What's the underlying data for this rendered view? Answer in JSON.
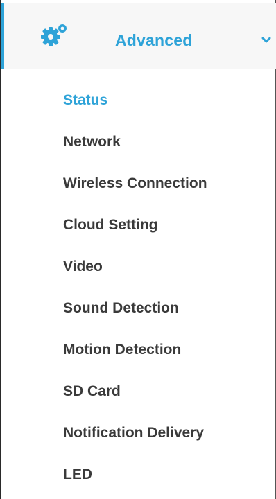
{
  "header": {
    "icon": "gears-icon",
    "label": "Advanced",
    "chevron_icon": "chevron-down-icon",
    "accent_color": "#2ea3d8"
  },
  "menu": {
    "items": [
      {
        "label": "Status",
        "active": true
      },
      {
        "label": "Network",
        "active": false
      },
      {
        "label": "Wireless Connection",
        "active": false
      },
      {
        "label": "Cloud Setting",
        "active": false
      },
      {
        "label": "Video",
        "active": false
      },
      {
        "label": "Sound Detection",
        "active": false
      },
      {
        "label": "Motion Detection",
        "active": false
      },
      {
        "label": "SD Card",
        "active": false
      },
      {
        "label": "Notification Delivery",
        "active": false
      },
      {
        "label": "LED",
        "active": false
      }
    ]
  }
}
